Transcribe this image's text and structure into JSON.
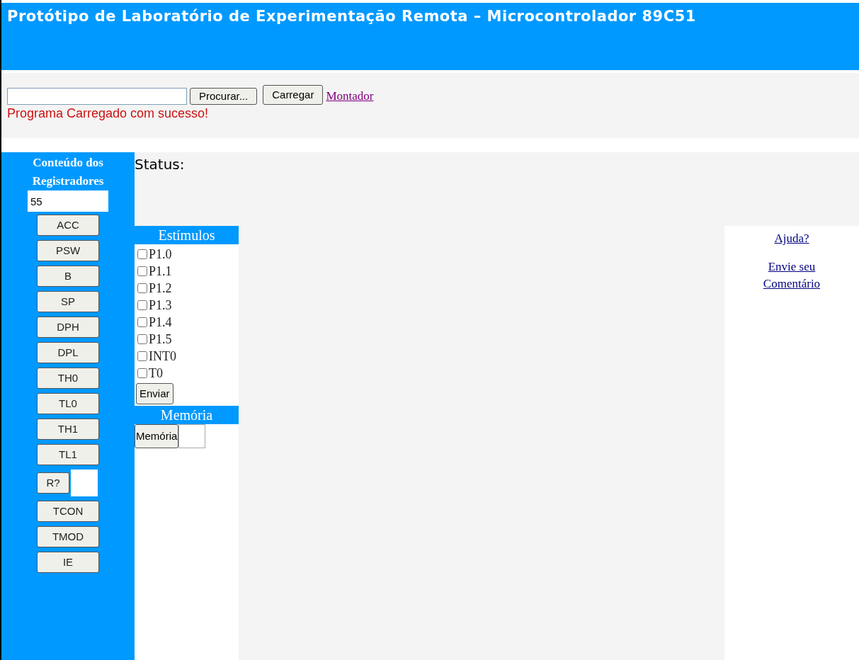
{
  "header": {
    "title": "Protótipo de Laboratório de Experimentação Remota – Microcontrolador 89C51"
  },
  "upload": {
    "browse_button": "Procurar...",
    "load_button": "Carregar",
    "assembler_link": "Montador",
    "message": "Programa Carregado com sucesso!"
  },
  "registers": {
    "title_lines": [
      "Conteúdo dos",
      "Registradores"
    ],
    "value": "55",
    "buttons": [
      {
        "label": "ACC",
        "kind": "button"
      },
      {
        "label": "PSW",
        "kind": "button"
      },
      {
        "label": "B",
        "kind": "button"
      },
      {
        "label": "SP",
        "kind": "button"
      },
      {
        "label": "DPH",
        "kind": "button"
      },
      {
        "label": "DPL",
        "kind": "button"
      },
      {
        "label": "TH0",
        "kind": "button"
      },
      {
        "label": "TL0",
        "kind": "button"
      },
      {
        "label": "TH1",
        "kind": "button"
      },
      {
        "label": "TL1",
        "kind": "button"
      },
      {
        "label": "R?",
        "kind": "with-field"
      },
      {
        "label": "TCON",
        "kind": "button"
      },
      {
        "label": "TMOD",
        "kind": "button"
      },
      {
        "label": "IE",
        "kind": "button"
      }
    ]
  },
  "status": {
    "label": "Status:"
  },
  "stimuli": {
    "title": "Estímulos",
    "inputs": [
      {
        "label": "P1.0",
        "checked": false
      },
      {
        "label": "P1.1",
        "checked": false
      },
      {
        "label": "P1.2",
        "checked": false
      },
      {
        "label": "P1.3",
        "checked": false
      },
      {
        "label": "P1.4",
        "checked": false
      },
      {
        "label": "P1.5",
        "checked": false
      },
      {
        "label": "INT0",
        "checked": false
      },
      {
        "label": "T0",
        "checked": false
      }
    ],
    "send_button": "Enviar"
  },
  "memory": {
    "title": "Memória",
    "button": "Memória"
  },
  "links": [
    "Ajuda?",
    "Envie seu Comentário"
  ]
}
